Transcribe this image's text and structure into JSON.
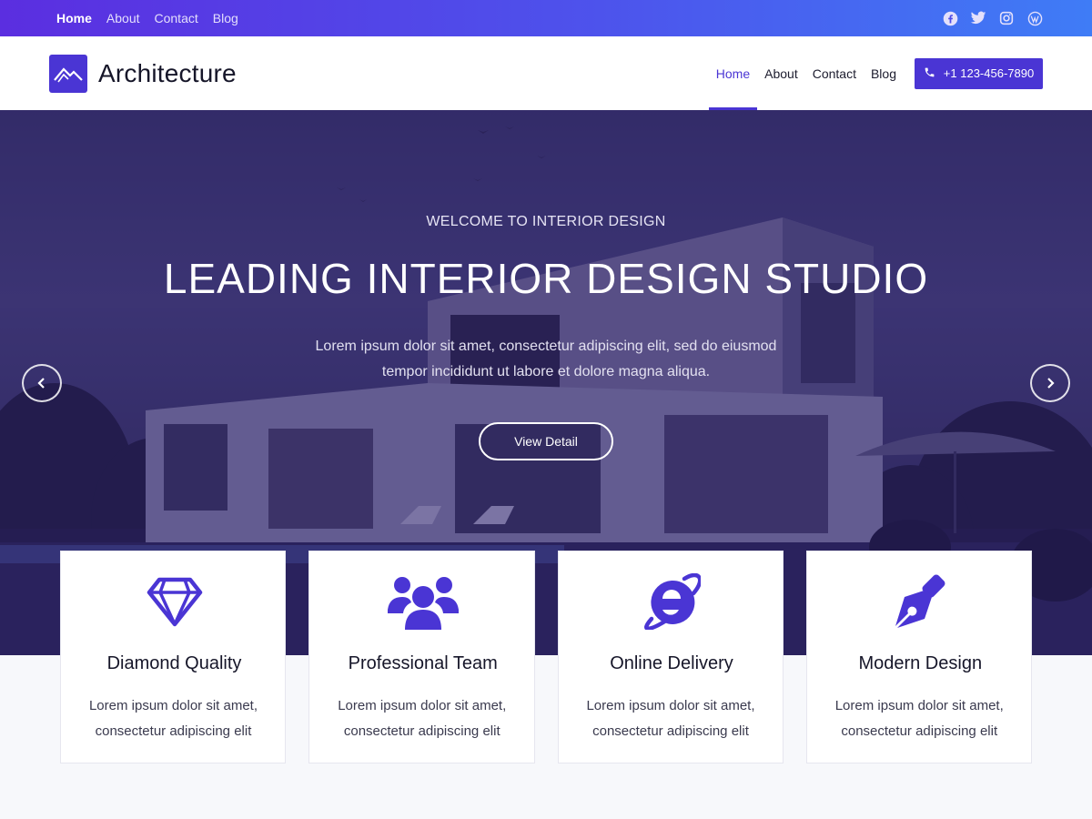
{
  "topbar": {
    "nav": [
      "Home",
      "About",
      "Contact",
      "Blog"
    ],
    "social_icons": [
      "facebook-icon",
      "twitter-icon",
      "instagram-icon",
      "wordpress-icon"
    ]
  },
  "header": {
    "brand": "Architecture",
    "nav": [
      "Home",
      "About",
      "Contact",
      "Blog"
    ],
    "phone": "+1 123-456-7890"
  },
  "hero": {
    "kicker": "WELCOME TO INTERIOR DESIGN",
    "title": "LEADING INTERIOR DESIGN STUDIO",
    "text": "Lorem ipsum dolor sit amet, consectetur adipiscing elit, sed do eiusmod tempor incididunt ut labore et dolore magna aliqua.",
    "button": "View Detail"
  },
  "features": [
    {
      "icon": "diamond-icon",
      "title": "Diamond Quality",
      "text": "Lorem ipsum dolor sit amet, consectetur adipiscing elit"
    },
    {
      "icon": "team-icon",
      "title": "Professional Team",
      "text": "Lorem ipsum dolor sit amet, consectetur adipiscing elit"
    },
    {
      "icon": "internet-explorer-icon",
      "title": "Online Delivery",
      "text": "Lorem ipsum dolor sit amet, consectetur adipiscing elit"
    },
    {
      "icon": "pen-nib-icon",
      "title": "Modern Design",
      "text": "Lorem ipsum dolor sit amet, consectetur adipiscing elit"
    }
  ],
  "colors": {
    "accent": "#4a35d4",
    "topbar_start": "#5b2ee0",
    "topbar_end": "#3f7cf6"
  }
}
